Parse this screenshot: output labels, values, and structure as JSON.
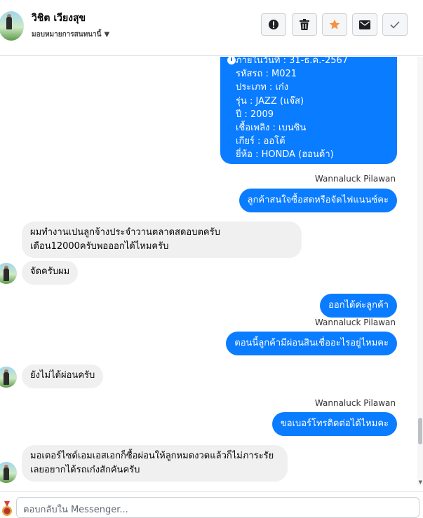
{
  "header": {
    "contact_name": "วิชิต เวียงสุข",
    "assignee": "มอบหมายการสนทนานี้",
    "buttons": [
      {
        "name": "report",
        "icon": "alert-icon"
      },
      {
        "name": "delete",
        "icon": "trash-icon"
      },
      {
        "name": "star",
        "icon": "star-icon",
        "color": "#f7923a"
      },
      {
        "name": "mark-unread",
        "icon": "envelope-icon"
      },
      {
        "name": "mark-done",
        "icon": "check-icon"
      }
    ]
  },
  "vehicle_details": {
    "lines": [
      "ภายในวันที่ : 31-ธ.ค.-2567",
      "รหัสรถ : M021",
      "ประเภท : เก๋ง",
      "รุ่น : JAZZ (แจ๊ส)",
      "ปี : 2009",
      "เชื้อเพลิง : เบนซิน",
      "เกียร์ : ออโต้",
      "ยี่ห้อ : HONDA (ฮอนด้า)"
    ]
  },
  "messages": [
    {
      "sender": "Wannaluck Pilawan",
      "text": "ลูกค้าสนใจซื้อสดหรือจัดไฟแนนซ์คะ"
    },
    {
      "text_line1": "ผมทำงานเปนลูกจ้างประจำวานตลาดสดอบตครับ",
      "text_line2": "เดือน12000ครับพอออกได้ไหมครับ"
    },
    {
      "text": "จัดครับผม"
    },
    {
      "text": "ออกได้ค่ะลูกค้า"
    },
    {
      "sender": "Wannaluck Pilawan",
      "text": "ตอนนี้ลูกค้ามีผ่อนสินเชื่ออะไรอยู่ไหมคะ"
    },
    {
      "text": "ยังไม่ได้ผ่อนครับ"
    },
    {
      "sender": "Wannaluck Pilawan",
      "text": "ขอเบอร์โทรติดต่อได้ไหมคะ"
    },
    {
      "text_line1": "มอเตอร์ไซด์เอมเอสเอกก็ซื้อผ่อนให้ลูกหมดงวดแล้วก็ไม่ภาระรัย",
      "text_line2": "เลยอยากได้รถเก๋งสักคันครับ"
    }
  ],
  "colors": {
    "outgoing": "#0a7cff",
    "incoming": "#f0f0f0"
  },
  "composer": {
    "placeholder": "ตอบกลับใน Messenger..."
  }
}
